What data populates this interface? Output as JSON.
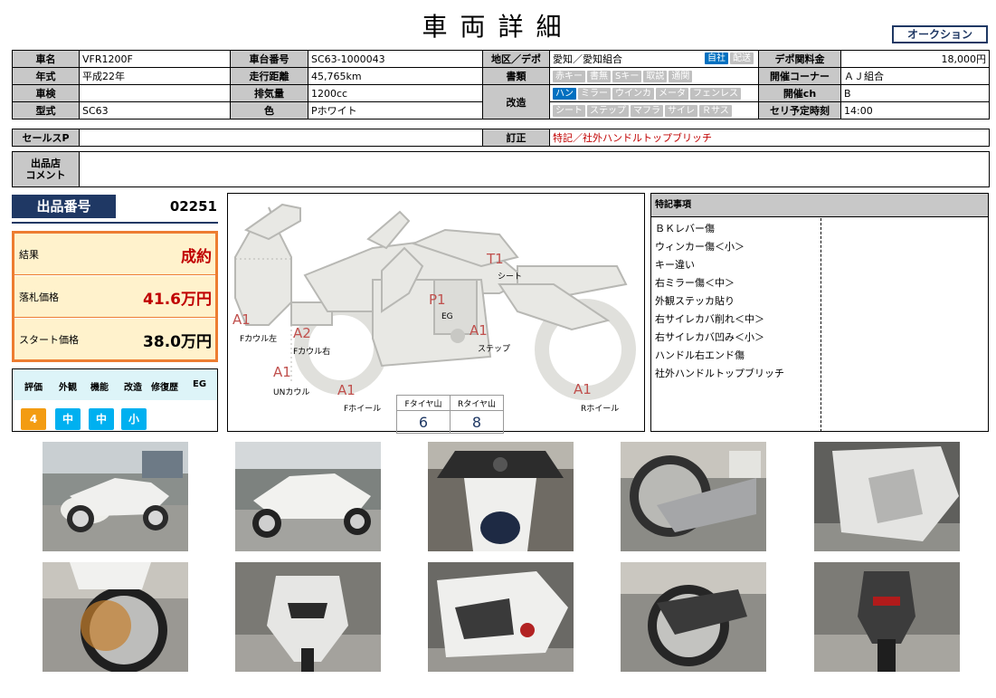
{
  "title": "車両詳細",
  "auction_button": "オークション",
  "info": {
    "name_label": "車名",
    "name": "VFR1200F",
    "frame_label": "車台番号",
    "frame": "SC63-1000043",
    "region_label": "地区／デポ",
    "region": "愛知／愛知組合",
    "region_tags": [
      {
        "label": "自社",
        "on": true
      },
      {
        "label": "配送",
        "on": false
      }
    ],
    "depo_fee_label": "デポ関料金",
    "depo_fee": "18,000円",
    "year_label": "年式",
    "year": "平成22年",
    "mileage_label": "走行距離",
    "mileage": "45,765km",
    "docs_label": "書類",
    "docs_tags": [
      {
        "label": "赤キー",
        "on": false
      },
      {
        "label": "書無",
        "on": false
      },
      {
        "label": "Sキー",
        "on": false
      },
      {
        "label": "取説",
        "on": false
      },
      {
        "label": "通関",
        "on": false
      }
    ],
    "corner_label": "開催コーナー",
    "corner": "ＡＪ組合",
    "inspection_label": "車検",
    "inspection": "",
    "displacement_label": "排気量",
    "displacement": "1200cc",
    "mod_label": "改造",
    "mod_tags_row1": [
      {
        "label": "ハン",
        "on": true
      },
      {
        "label": "ミラー",
        "on": false
      },
      {
        "label": "ウインカ",
        "on": false
      },
      {
        "label": "メータ",
        "on": false
      },
      {
        "label": "フェンレス",
        "on": false
      }
    ],
    "mod_tags_row2": [
      {
        "label": "シート",
        "on": false
      },
      {
        "label": "ステップ",
        "on": false
      },
      {
        "label": "マフラ",
        "on": false
      },
      {
        "label": "サイレ",
        "on": false
      },
      {
        "label": "Ｒサス",
        "on": false
      }
    ],
    "channel_label": "開催ch",
    "channel": "B",
    "model_label": "型式",
    "model": "SC63",
    "color_label": "色",
    "color": "Pホワイト",
    "time_label": "セリ予定時刻",
    "time": "14:00",
    "sales_label": "セールスP",
    "sales": "",
    "correction_label": "訂正",
    "correction": "特記／社外ハンドルトップブリッチ",
    "comment_label_1": "出品店",
    "comment_label_2": "コメント",
    "comment": ""
  },
  "lot": {
    "label": "出品番号",
    "number": "02251"
  },
  "result": {
    "result_label": "結果",
    "result_value": "成約",
    "hammer_label": "落札価格",
    "hammer_value": "41.6万円",
    "start_label": "スタート価格",
    "start_value": "38.0万円"
  },
  "grades": {
    "headers": [
      "評価",
      "外観",
      "機能",
      "改造",
      "修復歴",
      "EG"
    ],
    "values": [
      {
        "label": "4",
        "color": "#f39c12"
      },
      {
        "label": "中",
        "color": "#00b0f0"
      },
      {
        "label": "中",
        "color": "#00b0f0"
      },
      {
        "label": "小",
        "color": "#00b0f0"
      }
    ]
  },
  "diagram": {
    "codes": [
      {
        "code": "T1",
        "label": "シート"
      },
      {
        "code": "P1",
        "label": "EG"
      },
      {
        "code": "A1",
        "label": "ステップ"
      },
      {
        "code": "A1",
        "label": "Fカウル左"
      },
      {
        "code": "A2",
        "label": "Fカウル右"
      },
      {
        "code": "A1",
        "label": "UNカウル"
      },
      {
        "code": "A1",
        "label": "Fホイール"
      },
      {
        "code": "A1",
        "label": "Rホイール"
      }
    ],
    "tread_front_label": "Fタイヤ山",
    "tread_rear_label": "Rタイヤ山",
    "tread_front": "6",
    "tread_rear": "8"
  },
  "notes": {
    "header": "特記事項",
    "items": [
      "ＢＫレバー傷",
      "ウィンカー傷＜小＞",
      "キー違い",
      "右ミラー傷＜中＞",
      "外観ステッカ貼り",
      "右サイレカバ削れ＜中＞",
      "右サイレカバ凹み＜小＞",
      "ハンドル右エンド傷",
      "社外ハンドルトップブリッチ"
    ]
  }
}
